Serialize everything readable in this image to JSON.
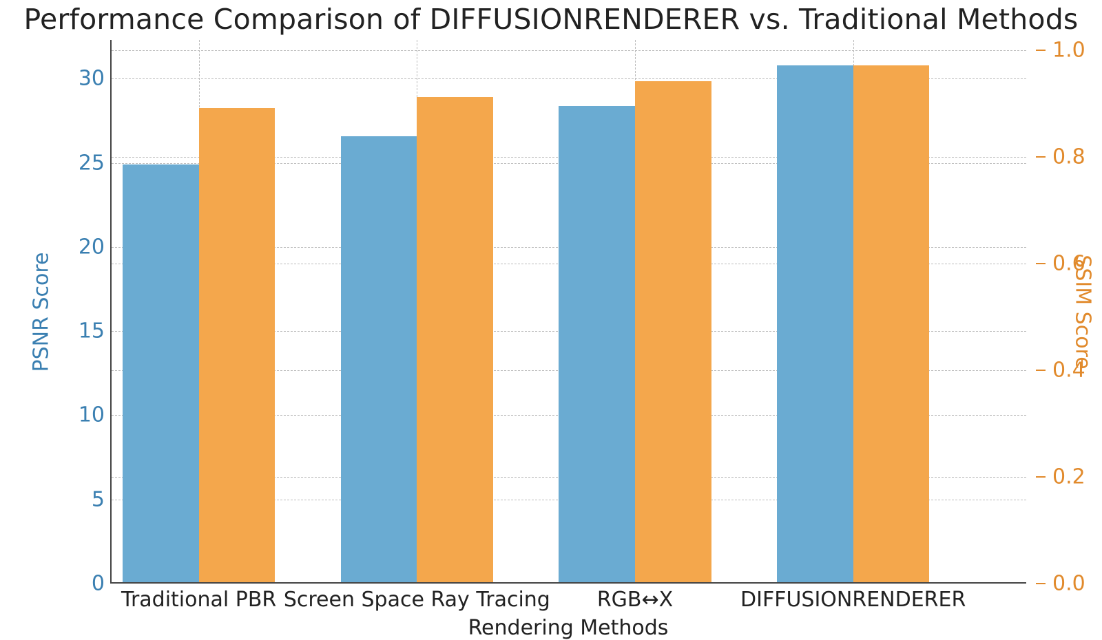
{
  "chart_data": {
    "type": "bar",
    "title": "Performance Comparison of DIFFUSIONRENDERER vs. Traditional Methods",
    "xlabel": "Rendering Methods",
    "categories": [
      "Traditional PBR",
      "Screen Space Ray Tracing",
      "RGB↔X",
      "DIFFUSIONRENDERER"
    ],
    "series": [
      {
        "name": "PSNR Score",
        "values": [
          24.8,
          26.5,
          28.3,
          30.7
        ],
        "axis": "left",
        "color": "#6aabd2"
      },
      {
        "name": "SSIM Score",
        "values": [
          0.89,
          0.91,
          0.94,
          0.97
        ],
        "axis": "right",
        "color": "#f4a74c"
      }
    ],
    "y_left": {
      "label": "PSNR Score",
      "min": 0,
      "max": 32.3,
      "ticks": [
        0,
        5,
        10,
        15,
        20,
        25,
        30
      ],
      "color": "#3a7fb1"
    },
    "y_right": {
      "label": "SSIM Score",
      "min": 0,
      "max": 1.02,
      "ticks": [
        0.0,
        0.2,
        0.4,
        0.6,
        0.8,
        1.0
      ],
      "color": "#e18a2c"
    },
    "x_range": [
      -0.4,
      3.8
    ],
    "bar_width": 0.35,
    "grid": true
  }
}
